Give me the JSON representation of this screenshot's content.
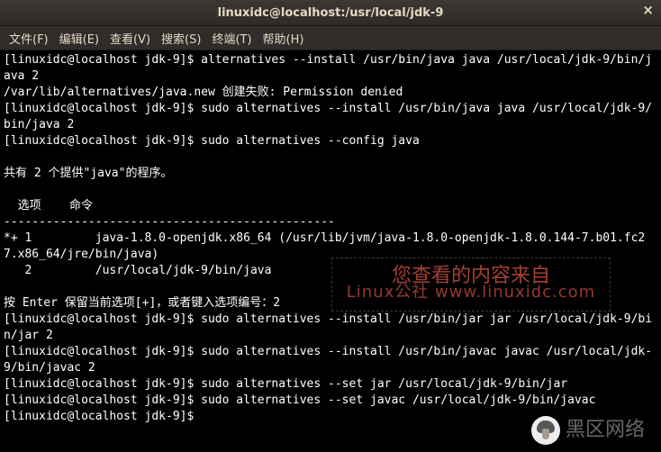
{
  "titlebar": {
    "title": "linuxidc@localhost:/usr/local/jdk-9",
    "close": "×"
  },
  "menubar": {
    "file": "文件(F)",
    "edit": "编辑(E)",
    "view": "查看(V)",
    "search": "搜索(S)",
    "terminal": "终端(T)",
    "help": "帮助(H)"
  },
  "lines": {
    "l1": "[linuxidc@localhost jdk-9]$ alternatives --install /usr/bin/java java /usr/local/jdk-9/bin/java 2",
    "l2": "/var/lib/alternatives/java.new 创建失败: Permission denied",
    "l3": "[linuxidc@localhost jdk-9]$ sudo alternatives --install /usr/bin/java java /usr/local/jdk-9/bin/java 2",
    "l4": "[linuxidc@localhost jdk-9]$ sudo alternatives --config java",
    "blank1": "",
    "l5": "共有 2 个提供\"java\"的程序。",
    "blank2": "",
    "l6": "  选项    命令",
    "l7": "-----------------------------------------------",
    "l8": "*+ 1         java-1.8.0-openjdk.x86_64 (/usr/lib/jvm/java-1.8.0-openjdk-1.8.0.144-7.b01.fc27.x86_64/jre/bin/java)",
    "l9": "   2         /usr/local/jdk-9/bin/java",
    "blank3": "",
    "l10": "按 Enter 保留当前选项[+]，或者键入选项编号：2",
    "l11": "[linuxidc@localhost jdk-9]$ sudo alternatives --install /usr/bin/jar jar /usr/local/jdk-9/bin/jar 2",
    "l12": "[linuxidc@localhost jdk-9]$ sudo alternatives --install /usr/bin/javac javac /usr/local/jdk-9/bin/javac 2",
    "l13": "[linuxidc@localhost jdk-9]$ sudo alternatives --set jar /usr/local/jdk-9/bin/jar",
    "l14": "[linuxidc@localhost jdk-9]$ sudo alternatives --set javac /usr/local/jdk-9/bin/javac",
    "l15": "[linuxidc@localhost jdk-9]$ "
  },
  "watermark1": {
    "line1": "您查看的内容来自",
    "line2": "Linux公社 www.linuxidc.com"
  },
  "watermark2": {
    "text": "黑区网络"
  }
}
